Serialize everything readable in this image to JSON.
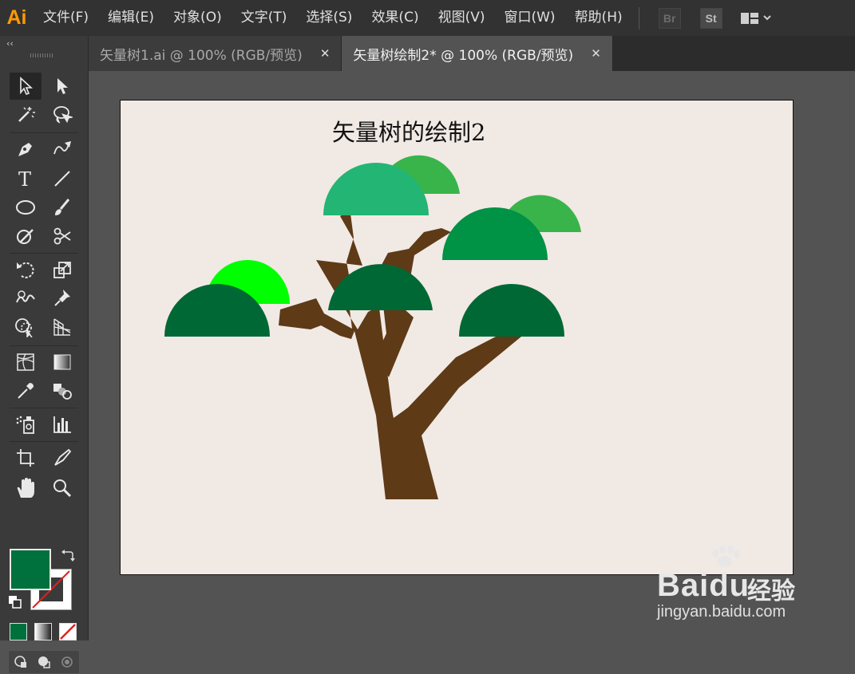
{
  "app": {
    "logo": "Ai",
    "accent": "#ff9a00"
  },
  "menu": [
    "文件(F)",
    "编辑(E)",
    "对象(O)",
    "文字(T)",
    "选择(S)",
    "效果(C)",
    "视图(V)",
    "窗口(W)",
    "帮助(H)"
  ],
  "bridge_badges": [
    "Br",
    "St"
  ],
  "panel": {
    "collapse_glyph": "‹‹"
  },
  "tabs": [
    {
      "label": "矢量树1.ai @ 100% (RGB/预览)",
      "close": "✕",
      "active": false
    },
    {
      "label": "矢量树绘制2* @ 100% (RGB/预览)",
      "close": "✕",
      "active": true
    }
  ],
  "tools": [
    "selection-tool-icon",
    "direct-selection-tool-icon",
    "magic-wand-tool-icon",
    "lasso-tool-icon",
    "pen-tool-icon",
    "curvature-tool-icon",
    "type-tool-icon",
    "line-segment-tool-icon",
    "ellipse-tool-icon",
    "paintbrush-tool-icon",
    "shaper-tool-icon",
    "scissors-tool-icon",
    "rotate-tool-icon",
    "scale-tool-icon",
    "warp-tool-icon",
    "puppet-warp-tool-icon",
    "shape-builder-tool-icon",
    "perspective-grid-tool-icon",
    "mesh-tool-icon",
    "gradient-tool-icon",
    "eyedropper-tool-icon",
    "blend-tool-icon",
    "symbol-sprayer-tool-icon",
    "column-graph-tool-icon",
    "artboard-tool-icon",
    "slice-tool-icon",
    "hand-tool-icon",
    "zoom-tool-icon"
  ],
  "colors": {
    "fill": "#00703c",
    "trunk": "#5e3a17",
    "artboard": "#f1e9e4",
    "leaf_teal": "#23b573",
    "leaf_green": "#39b44a",
    "leaf_mid": "#009245",
    "leaf_dark": "#006835",
    "leaf_lime": "#00ff00"
  },
  "artboard": {
    "title": "矢量树的绘制2"
  },
  "watermark": {
    "brand": "Bai",
    "brand_paw": "du",
    "brand_cn": "经验",
    "url": "jingyan.baidu.com"
  }
}
